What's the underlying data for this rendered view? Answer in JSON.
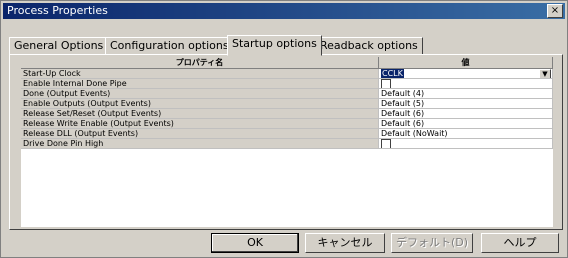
{
  "window": {
    "title": "Process Properties",
    "close_glyph": "×"
  },
  "tabs": [
    {
      "label": "General Options",
      "active": false
    },
    {
      "label": "Configuration options",
      "active": false
    },
    {
      "label": "Startup options",
      "active": true
    },
    {
      "label": "Readback options",
      "active": false
    }
  ],
  "grid": {
    "headers": {
      "name": "プロパティ名",
      "value": "値"
    },
    "rows": [
      {
        "name": "Start-Up Clock",
        "type": "dropdown",
        "value": "CCLK"
      },
      {
        "name": "Enable Internal Done Pipe",
        "type": "checkbox",
        "value": ""
      },
      {
        "name": "Done (Output Events)",
        "type": "text",
        "value": "Default (4)"
      },
      {
        "name": "Enable Outputs (Output Events)",
        "type": "text",
        "value": "Default (5)"
      },
      {
        "name": "Release Set/Reset (Output Events)",
        "type": "text",
        "value": "Default (6)"
      },
      {
        "name": "Release Write Enable (Output Events)",
        "type": "text",
        "value": "Default (6)"
      },
      {
        "name": "Release DLL (Output Events)",
        "type": "text",
        "value": "Default (NoWait)"
      },
      {
        "name": "Drive Done Pin High",
        "type": "checkbox",
        "value": ""
      }
    ]
  },
  "buttons": {
    "ok": "OK",
    "cancel": "キャンセル",
    "default": "デフォルト(D)",
    "help": "ヘルプ"
  }
}
